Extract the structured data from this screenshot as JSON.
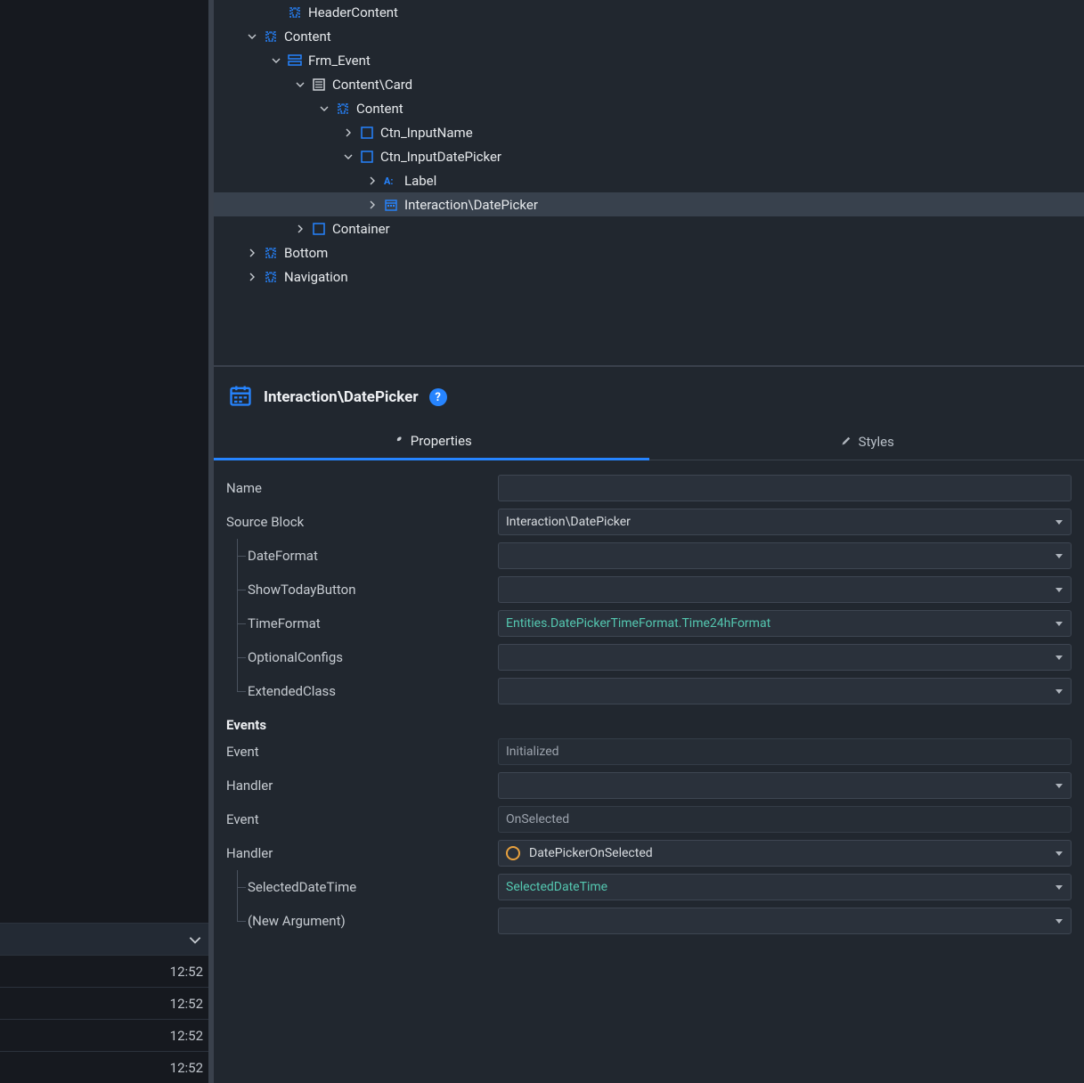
{
  "left": {
    "times": [
      "12:52",
      "12:52",
      "12:52",
      "12:52"
    ]
  },
  "tree": {
    "nodes": [
      {
        "depth": 2,
        "icon": "placeholder",
        "expander": "none",
        "label": "HeaderContent"
      },
      {
        "depth": 1,
        "icon": "placeholder",
        "expander": "down",
        "label": "Content"
      },
      {
        "depth": 2,
        "icon": "form",
        "expander": "down",
        "label": "Frm_Event"
      },
      {
        "depth": 3,
        "icon": "card",
        "expander": "down",
        "label": "Content\\Card"
      },
      {
        "depth": 4,
        "icon": "placeholder",
        "expander": "down",
        "label": "Content"
      },
      {
        "depth": 5,
        "icon": "container",
        "expander": "right",
        "label": "Ctn_InputName"
      },
      {
        "depth": 5,
        "icon": "container",
        "expander": "down",
        "label": "Ctn_InputDatePicker"
      },
      {
        "depth": 6,
        "icon": "text",
        "expander": "right",
        "label": "Label"
      },
      {
        "depth": 6,
        "icon": "datepicker",
        "expander": "right",
        "label": "Interaction\\DatePicker",
        "selected": true
      },
      {
        "depth": 3,
        "icon": "container",
        "expander": "right",
        "label": "Container"
      },
      {
        "depth": 1,
        "icon": "placeholder",
        "expander": "right",
        "label": "Bottom"
      },
      {
        "depth": 1,
        "icon": "placeholder",
        "expander": "right",
        "label": "Navigation"
      }
    ]
  },
  "props": {
    "header_title": "Interaction\\DatePicker",
    "help": "?",
    "tabs": {
      "properties": "Properties",
      "styles": "Styles"
    },
    "rows": {
      "name": "Name",
      "source_block": "Source Block",
      "source_block_value": "Interaction\\DatePicker",
      "date_format": "DateFormat",
      "show_today": "ShowTodayButton",
      "time_format": "TimeFormat",
      "time_format_value": "Entities.DatePickerTimeFormat.Time24hFormat",
      "optional_configs": "OptionalConfigs",
      "extended_class": "ExtendedClass",
      "events": "Events",
      "event": "Event",
      "event1_value": "Initialized",
      "handler": "Handler",
      "event2_value": "OnSelected",
      "handler2_value": "DatePickerOnSelected",
      "selected_dt": "SelectedDateTime",
      "selected_dt_value": "SelectedDateTime",
      "new_arg": "(New Argument)"
    }
  }
}
